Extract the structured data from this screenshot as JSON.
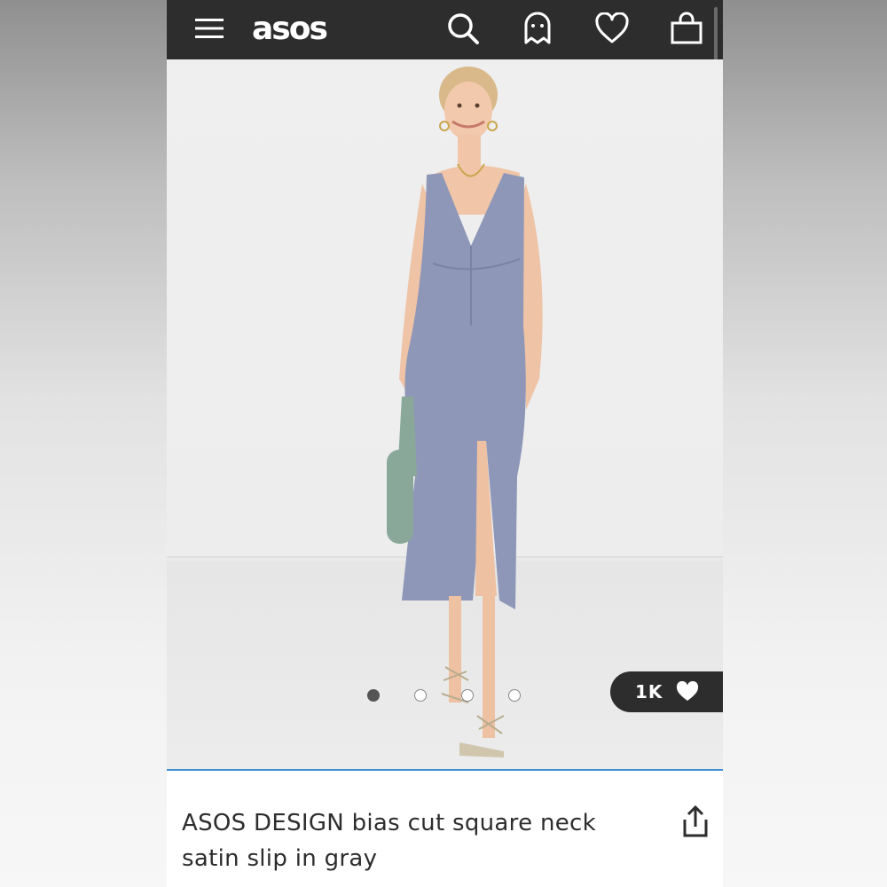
{
  "header": {
    "logo_text": "asos",
    "icons": [
      "menu-icon",
      "search-icon",
      "account-icon",
      "wishlist-heart-icon",
      "bag-icon"
    ],
    "background": "#2d2d2d"
  },
  "product_image": {
    "alt_subject": "Model wearing gray satin slip dress holding a green bag",
    "carousel": {
      "total": 4,
      "active_index": 0
    },
    "likes": {
      "count": "1K",
      "icon": "heart-icon"
    }
  },
  "product": {
    "title": "ASOS DESIGN bias cut square neck satin slip in gray",
    "share_icon": "share-icon"
  },
  "colors": {
    "accent_line": "#3f8fd8",
    "dress": "#8e97b8",
    "bag": "#8aa89a"
  }
}
